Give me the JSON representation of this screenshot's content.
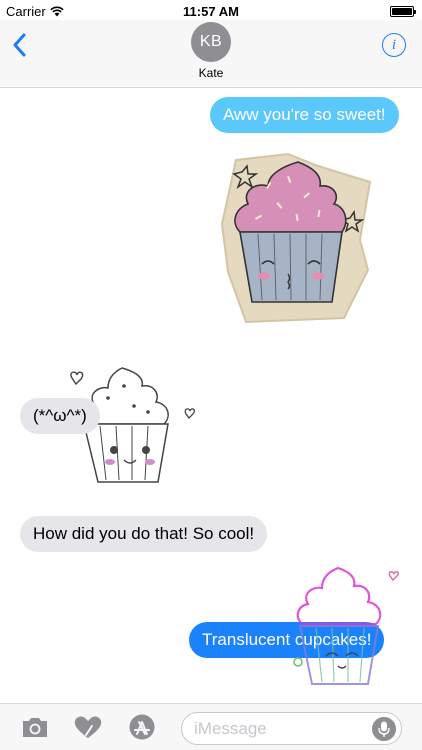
{
  "status_bar": {
    "carrier": "Carrier",
    "time": "11:57 AM",
    "wifi_icon": "wifi-icon",
    "battery_icon": "battery-icon"
  },
  "header": {
    "back_icon": "chevron-left-icon",
    "avatar_initials": "KB",
    "contact_name": "Kate",
    "info_icon": "info-icon",
    "info_glyph": "i"
  },
  "messages": [
    {
      "type": "sent",
      "text": "Aww you're so sweet!"
    },
    {
      "type": "sticker",
      "sticker": "pink-cupcake-sticker"
    },
    {
      "type": "received",
      "text": "(*^ω^*)"
    },
    {
      "type": "sticker",
      "sticker": "sketch-cupcake-sticker"
    },
    {
      "type": "received",
      "text": "How did you do that! So cool!"
    },
    {
      "type": "sent",
      "text": "Translucent cupcakes!"
    },
    {
      "type": "sticker",
      "sticker": "rainbow-cupcake-sticker"
    }
  ],
  "input_bar": {
    "camera_icon": "camera-icon",
    "digital_touch_icon": "heart-touch-icon",
    "app_store_icon": "app-store-icon",
    "placeholder": "iMessage",
    "mic_icon": "microphone-icon"
  },
  "colors": {
    "sent_light": "#5ac8fa",
    "sent_dark": "#1a82fb",
    "received": "#e5e5ea",
    "accent": "#1a7df7"
  }
}
